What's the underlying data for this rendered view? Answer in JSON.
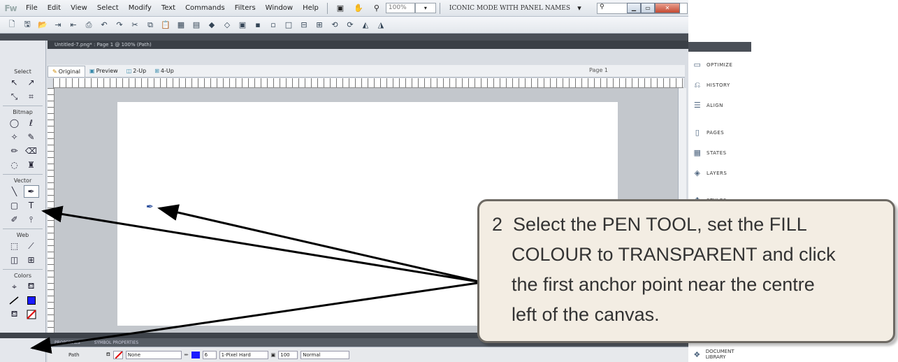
{
  "app": {
    "logo": "Fw",
    "menus": [
      "File",
      "Edit",
      "View",
      "Select",
      "Modify",
      "Text",
      "Commands",
      "Filters",
      "Window",
      "Help"
    ],
    "zoom_value": "100%",
    "workspace_mode": "ICONIC MODE WITH PANEL NAMES"
  },
  "document": {
    "tab_title": "Untitled-7.png* : Page 1 @ 100% (Path)",
    "view_tabs": [
      "Original",
      "Preview",
      "2-Up",
      "4-Up"
    ],
    "page_indicator": "Page 1"
  },
  "tools": {
    "sections": [
      "Select",
      "Bitmap",
      "Vector",
      "Web",
      "Colors"
    ]
  },
  "properties": {
    "tabs": [
      "PROPERTIES",
      "SYMBOL PROPERTIES"
    ],
    "object_type": "Path",
    "fill_value": "None",
    "stroke_size": "6",
    "stroke_type": "1-Pixel Hard",
    "opacity": "100",
    "blend_mode": "Normal"
  },
  "panels": {
    "items": [
      "OPTIMIZE",
      "HISTORY",
      "ALIGN",
      "PAGES",
      "STATES",
      "LAYERS",
      "STYLES"
    ],
    "bottom_item": "DOCUMENT LIBRARY"
  },
  "callout": {
    "step_number": "2",
    "lines": [
      "Select the PEN TOOL, set the FILL",
      "COLOUR to TRANSPARENT and click",
      "the first anchor point near the centre",
      "left of the canvas."
    ]
  },
  "colors": {
    "callout_bg": "#f3ede3",
    "callout_border": "#6e6a64",
    "stroke_swatch": "#1a1aff"
  }
}
